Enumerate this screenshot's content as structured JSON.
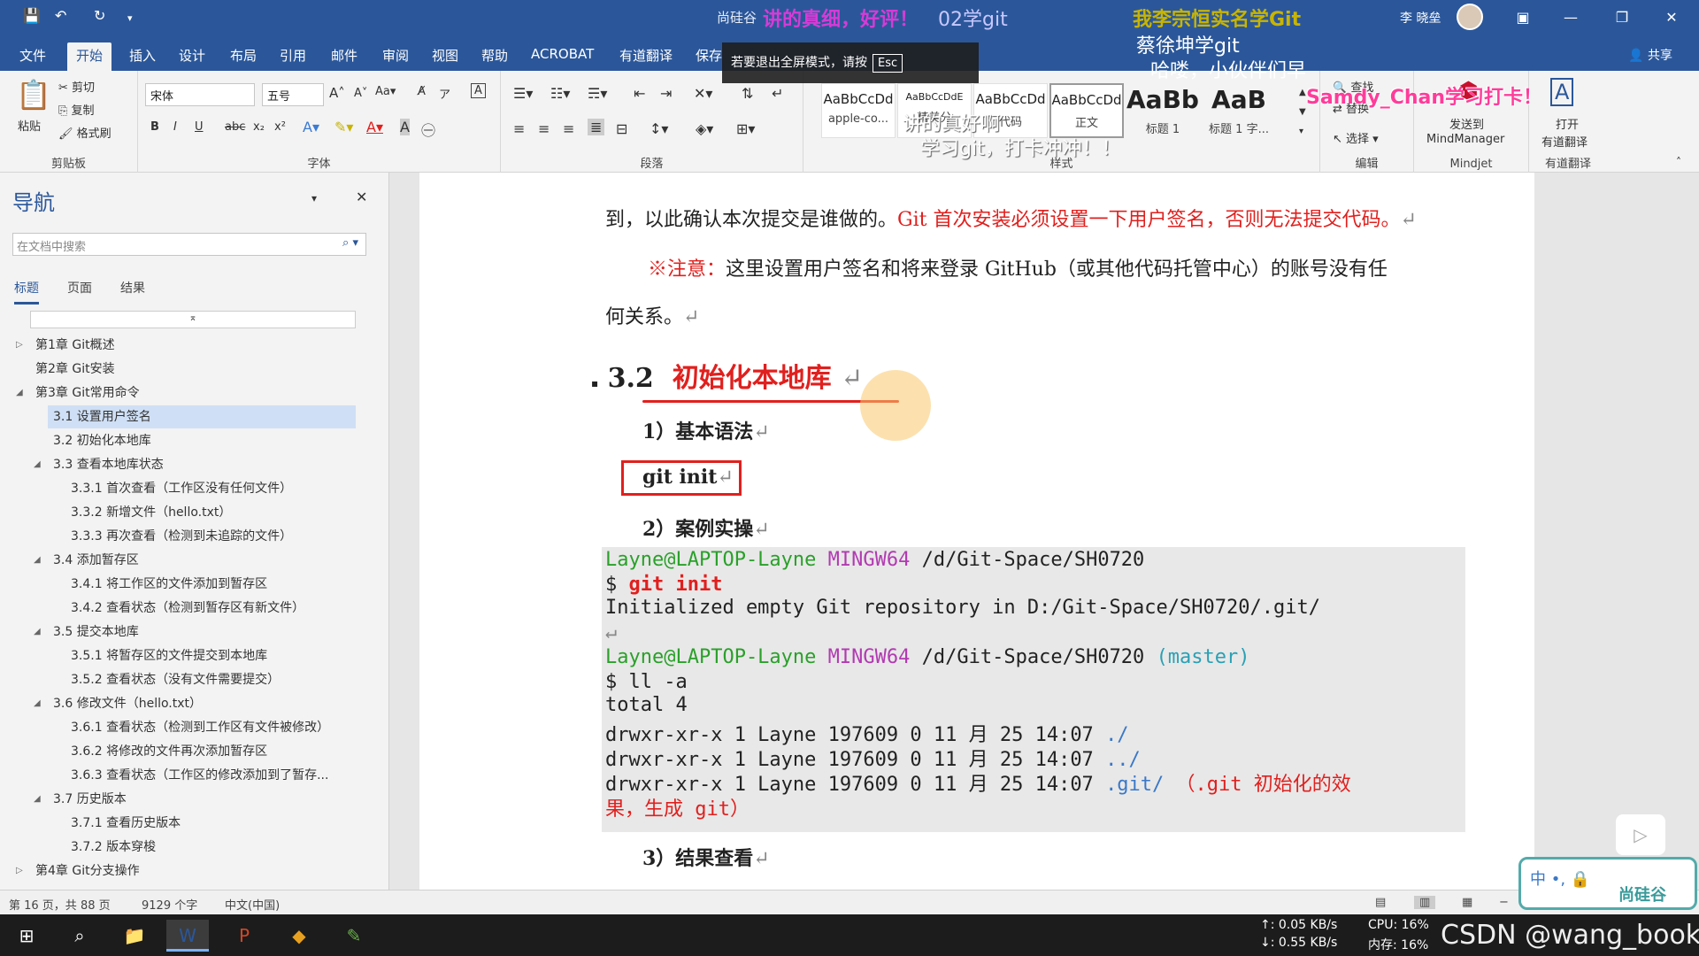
{
  "titlebar": {
    "doc_title": "尚硅谷",
    "user_name": "李 晓垒"
  },
  "menu": {
    "tabs": [
      "文件",
      "开始",
      "插入",
      "设计",
      "布局",
      "引用",
      "邮件",
      "审阅",
      "视图",
      "帮助",
      "ACROBAT",
      "有道翻译",
      "保存"
    ],
    "active": "开始",
    "share": "共享"
  },
  "ribbon": {
    "clipboard": {
      "paste": "粘贴",
      "cut": "剪切",
      "copy": "复制",
      "format_painter": "格式刷",
      "label": "剪贴板"
    },
    "font": {
      "family": "宋体",
      "size": "五号",
      "label": "字体",
      "bold": "B",
      "italic": "I",
      "underline": "U",
      "strike": "abc",
      "sub": "x₂",
      "sup": "x²"
    },
    "paragraph": {
      "label": "段落"
    },
    "styles": {
      "label": "样式",
      "items": [
        {
          "preview": "AaBbCcDd",
          "name": "apple-co..."
        },
        {
          "preview": "AaBbCcDdE",
          "name": "精美分"
        },
        {
          "preview": "AaBbCcDd",
          "name": "代码"
        },
        {
          "preview": "AaBbCcDd",
          "name": "正文"
        },
        {
          "preview": "AaBb",
          "name": "标题 1"
        },
        {
          "preview": "AaB",
          "name": "标题 1 字..."
        }
      ]
    },
    "editing": {
      "find": "查找",
      "replace": "替换",
      "select": "选择",
      "label": "编辑"
    },
    "mindjet": {
      "send_to": "发送到",
      "app": "MindManager",
      "label": "Mindjet"
    },
    "youdao": {
      "open": "打开",
      "translate": "有道翻译",
      "label": "有道翻译"
    }
  },
  "nav": {
    "title": "导航",
    "search_placeholder": "在文档中搜索",
    "tabs": [
      "标题",
      "页面",
      "结果"
    ],
    "active_tab": "标题",
    "items": [
      {
        "text": "第1章 Git概述",
        "level": 1,
        "arrow": "▷"
      },
      {
        "text": "第2章 Git安装",
        "level": 1,
        "arrow": ""
      },
      {
        "text": "第3章 Git常用命令",
        "level": 1,
        "arrow": "◢"
      },
      {
        "text": "3.1 设置用户签名",
        "level": 2,
        "arrow": "",
        "selected": true
      },
      {
        "text": "3.2 初始化本地库",
        "level": 2,
        "arrow": ""
      },
      {
        "text": "3.3 查看本地库状态",
        "level": 2,
        "arrow": "◢"
      },
      {
        "text": "3.3.1 首次查看（工作区没有任何文件）",
        "level": 3,
        "arrow": ""
      },
      {
        "text": "3.3.2 新增文件（hello.txt）",
        "level": 3,
        "arrow": ""
      },
      {
        "text": "3.3.3 再次查看（检测到未追踪的文件）",
        "level": 3,
        "arrow": ""
      },
      {
        "text": "3.4 添加暂存区",
        "level": 2,
        "arrow": "◢"
      },
      {
        "text": "3.4.1 将工作区的文件添加到暂存区",
        "level": 3,
        "arrow": ""
      },
      {
        "text": "3.4.2 查看状态（检测到暂存区有新文件）",
        "level": 3,
        "arrow": ""
      },
      {
        "text": "3.5 提交本地库",
        "level": 2,
        "arrow": "◢"
      },
      {
        "text": "3.5.1 将暂存区的文件提交到本地库",
        "level": 3,
        "arrow": ""
      },
      {
        "text": "3.5.2 查看状态（没有文件需要提交）",
        "level": 3,
        "arrow": ""
      },
      {
        "text": "3.6 修改文件（hello.txt）",
        "level": 2,
        "arrow": "◢"
      },
      {
        "text": "3.6.1 查看状态（检测到工作区有文件被修改）",
        "level": 3,
        "arrow": ""
      },
      {
        "text": "3.6.2 将修改的文件再次添加暂存区",
        "level": 3,
        "arrow": ""
      },
      {
        "text": "3.6.3 查看状态（工作区的修改添加到了暂存...",
        "level": 3,
        "arrow": ""
      },
      {
        "text": "3.7 历史版本",
        "level": 2,
        "arrow": "◢"
      },
      {
        "text": "3.7.1 查看历史版本",
        "level": 3,
        "arrow": ""
      },
      {
        "text": "3.7.2 版本穿梭",
        "level": 3,
        "arrow": ""
      },
      {
        "text": "第4章 Git分支操作",
        "level": 1,
        "arrow": "▷"
      }
    ]
  },
  "doc": {
    "line_partial": "到，以此确认本次提交是谁做的。",
    "line_partial_red": "Git 首次安装必须设置一下用户签名，否则无法提交代码。",
    "note_label": "※注意：",
    "note_text": "这里设置用户签名和将来登录 GitHub（或其他代码托管中心）的账号没有任",
    "note_tail": "何关系。",
    "heading_num": "3.2",
    "heading_text": "初始化本地库",
    "sub1": "1）基本语法",
    "syntax": "git init",
    "sub2": "2）案例实操",
    "sub3": "3）结果查看",
    "code": {
      "prompt_user": "Layne@LAPTOP-Layne",
      "prompt_env": "MINGW64",
      "prompt_path": "/d/Git-Space/SH0720",
      "cmd1_dollar": "$",
      "cmd1": "git init",
      "out1": "Initialized empty Git repository in D:/Git-Space/SH0720/.git/",
      "branch": "(master)",
      "cmd2": "$ ll -a",
      "out2": "total 4",
      "row1": "drwxr-xr-x 1 Layne 197609 0 11 月 25 14:07",
      "row1_name": "./",
      "row2": "drwxr-xr-x 1 Layne 197609 0 11 月 25 14:07",
      "row2_name": "../",
      "row3": "drwxr-xr-x 1 Layne 197609 0 11 月 25 14:07",
      "row3_name": ".git/",
      "row3_note": "（.git 初始化的效",
      "row3_note2": "果，生成 git）"
    }
  },
  "statusbar": {
    "page": "第 16 页，共 88 页",
    "words": "9129 个字",
    "lang": "中文(中国)"
  },
  "toast": {
    "text": "若要退出全屏模式，请按",
    "key": "Esc"
  },
  "danmaku": [
    {
      "text": "讲的真细，好评！",
      "color": "#d63bd6"
    },
    {
      "text": "我李宗恒实名学Git",
      "color": "#c8b400"
    },
    {
      "text": "蔡徐坤学git",
      "color": "#ffffff"
    },
    {
      "text": "哈喽，小伙伴们早",
      "color": "#ffffff"
    },
    {
      "text": "Samdy_Chan学习打卡！",
      "color": "#ff3c9a"
    },
    {
      "text": "讲的真好啊",
      "color": "#ffffff"
    },
    {
      "text": "学习git，打卡冲冲！！",
      "color": "#ffffff"
    },
    {
      "text": "02学git",
      "color": "#c8c8ff"
    }
  ],
  "tray": {
    "up": "↑: 0.05 KB/s",
    "down": "↓: 0.55 KB/s",
    "cpu": "CPU: 16%",
    "mem": "内存: 16%",
    "watermark": "CSDN @wang_book"
  },
  "sticker": {
    "text1": "中 •, 🔒",
    "text2": "尚硅谷"
  },
  "colors": {
    "word_blue": "#2b579a",
    "heading_red": "#e0201e",
    "code_bg": "#e8e8e8"
  }
}
